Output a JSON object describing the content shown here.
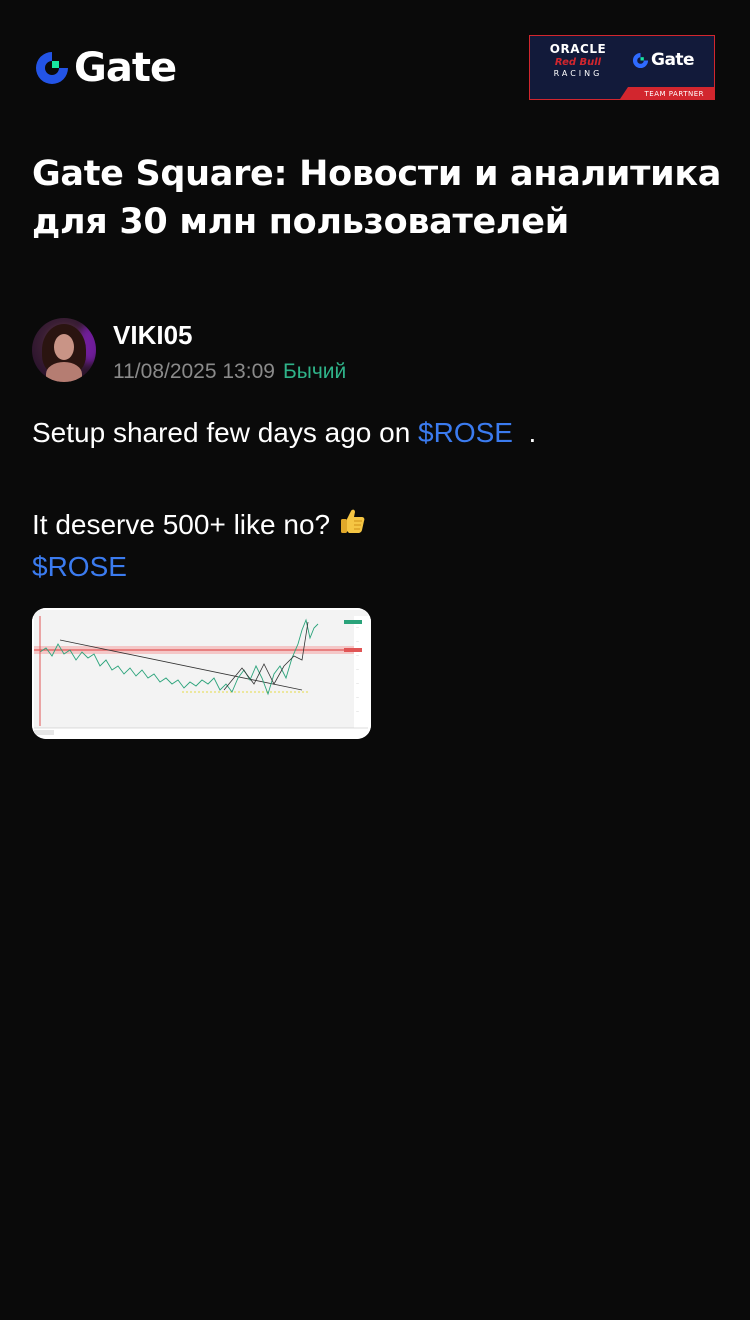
{
  "header": {
    "logo_text": "Gate",
    "partner_badge": {
      "oracle": "ORACLE",
      "redbull": "Red Bull",
      "racing": "RACING",
      "gate": "Gate",
      "team_partner": "TEAM PARTNER"
    }
  },
  "page": {
    "title": "Gate Square: Новости и аналитика для 30 млн пользователей"
  },
  "post": {
    "author": "VIKI05",
    "timestamp": "11/08/2025 13:09",
    "sentiment": "Бычий",
    "line1_text": "Setup shared few days ago on ",
    "line1_ticker": "$ROSE",
    "line1_suffix": "  .",
    "line2_text": "It deserve 500+ like no?",
    "line2_emoji": "thumbs-up-icon",
    "line3_ticker": "$ROSE"
  },
  "colors": {
    "background": "#0a0a0a",
    "ticker": "#3b7bef",
    "sentiment_bullish": "#2fb389",
    "muted": "#8a8a8a",
    "brand_blue": "#2354e6",
    "brand_green": "#17e5a2"
  }
}
